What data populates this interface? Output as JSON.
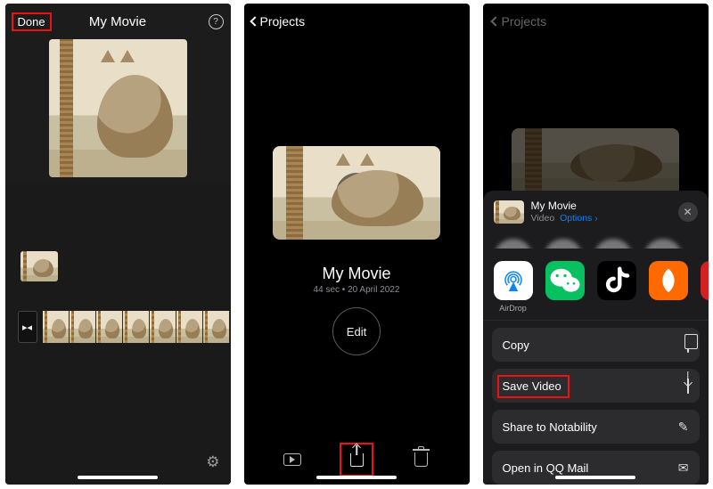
{
  "screen1": {
    "done": "Done",
    "title": "My Movie"
  },
  "screen2": {
    "back": "Projects",
    "title": "My Movie",
    "subtitle": "44 sec • 20 April 2022",
    "edit": "Edit"
  },
  "screen3": {
    "back": "Projects",
    "share_title": "My Movie",
    "share_kind": "Video",
    "share_options": "Options",
    "apps": {
      "airdrop": "AirDrop"
    },
    "actions": {
      "copy": "Copy",
      "save": "Save Video",
      "notability": "Share to Notability",
      "qqmail": "Open in QQ Mail"
    }
  }
}
